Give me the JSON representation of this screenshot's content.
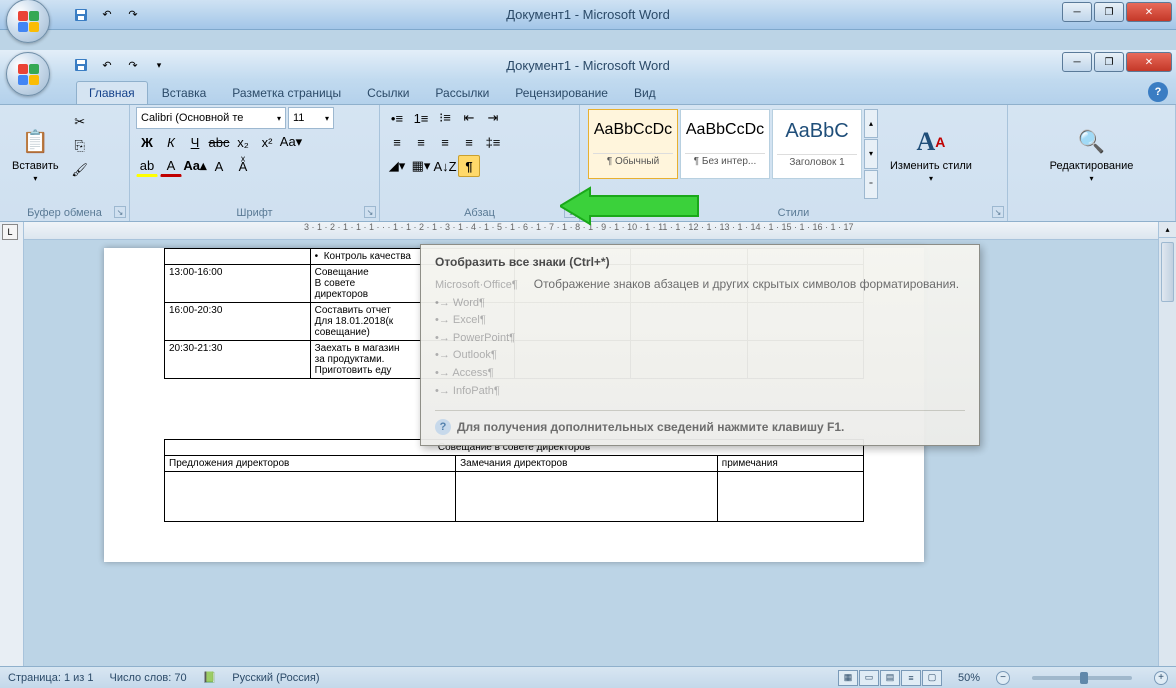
{
  "titlebar_back": {
    "title": "Документ1 - Microsoft Word"
  },
  "titlebar_front": {
    "title": "Документ1 - Microsoft Word"
  },
  "tabs": {
    "home": "Главная",
    "insert": "Вставка",
    "page_layout": "Разметка страницы",
    "references": "Ссылки",
    "mailings": "Рассылки",
    "review": "Рецензирование",
    "view": "Вид"
  },
  "ribbon": {
    "clipboard": {
      "label": "Буфер обмена",
      "paste": "Вставить"
    },
    "font": {
      "label": "Шрифт",
      "family": "Calibri (Основной те",
      "size": "11"
    },
    "paragraph": {
      "label": "Абзац"
    },
    "styles": {
      "label": "Стили",
      "change": "Изменить стили",
      "items": [
        {
          "preview": "AaBbCcDc",
          "name": "¶ Обычный"
        },
        {
          "preview": "AaBbCcDc",
          "name": "¶ Без интер..."
        },
        {
          "preview": "AaBbC",
          "name": "Заголовок 1"
        }
      ]
    },
    "editing": {
      "label": "Редактирование"
    }
  },
  "ruler": "3 · 1 · 2 · 1 · 1 · 1 · · · 1 · 1 · 2 · 1 · 3 · 1 · 4 · 1 · 5 · 1 · 6 · 1 · 7 · 1 · 8 · 1 · 9 · 1 · 10 · 1 · 11 · 1 · 12 · 1 · 13 · 1 · 14 · 1 · 15 · 1 · 16 · 1 · 17",
  "vruler_mode": "L",
  "tooltip": {
    "title": "Отобразить все знаки (Ctrl+*)",
    "ghost_heading": "Microsoft·Office¶",
    "ghost_items": [
      "Word¶",
      "Excel¶",
      "PowerPoint¶",
      "Outlook¶",
      "Access¶",
      "InfoPath¶"
    ],
    "description": "Отображение знаков абзацев и других скрытых символов форматирования.",
    "footer": "Для получения дополнительных сведений нажмите клавишу F1."
  },
  "document": {
    "table1_extra": "Контроль качества",
    "table1": [
      {
        "time": "13:00-16:00",
        "task": "Совещание\nВ совете\nдиректоров"
      },
      {
        "time": "16:00-20:30",
        "task": "Составить отчет\nДля 18.01.2018(к\nсовещание)"
      },
      {
        "time": "20:30-21:30",
        "task": "Заехать в магазин\nза продуктами.\nПриготовить еду"
      }
    ],
    "table2": {
      "title": "Совещание в совете директоров",
      "headers": [
        "Предложения директоров",
        "Замечания директоров",
        "примечания"
      ]
    }
  },
  "statusbar": {
    "page": "Страница: 1 из 1",
    "words": "Число слов: 70",
    "language": "Русский (Россия)",
    "zoom": "50%"
  }
}
